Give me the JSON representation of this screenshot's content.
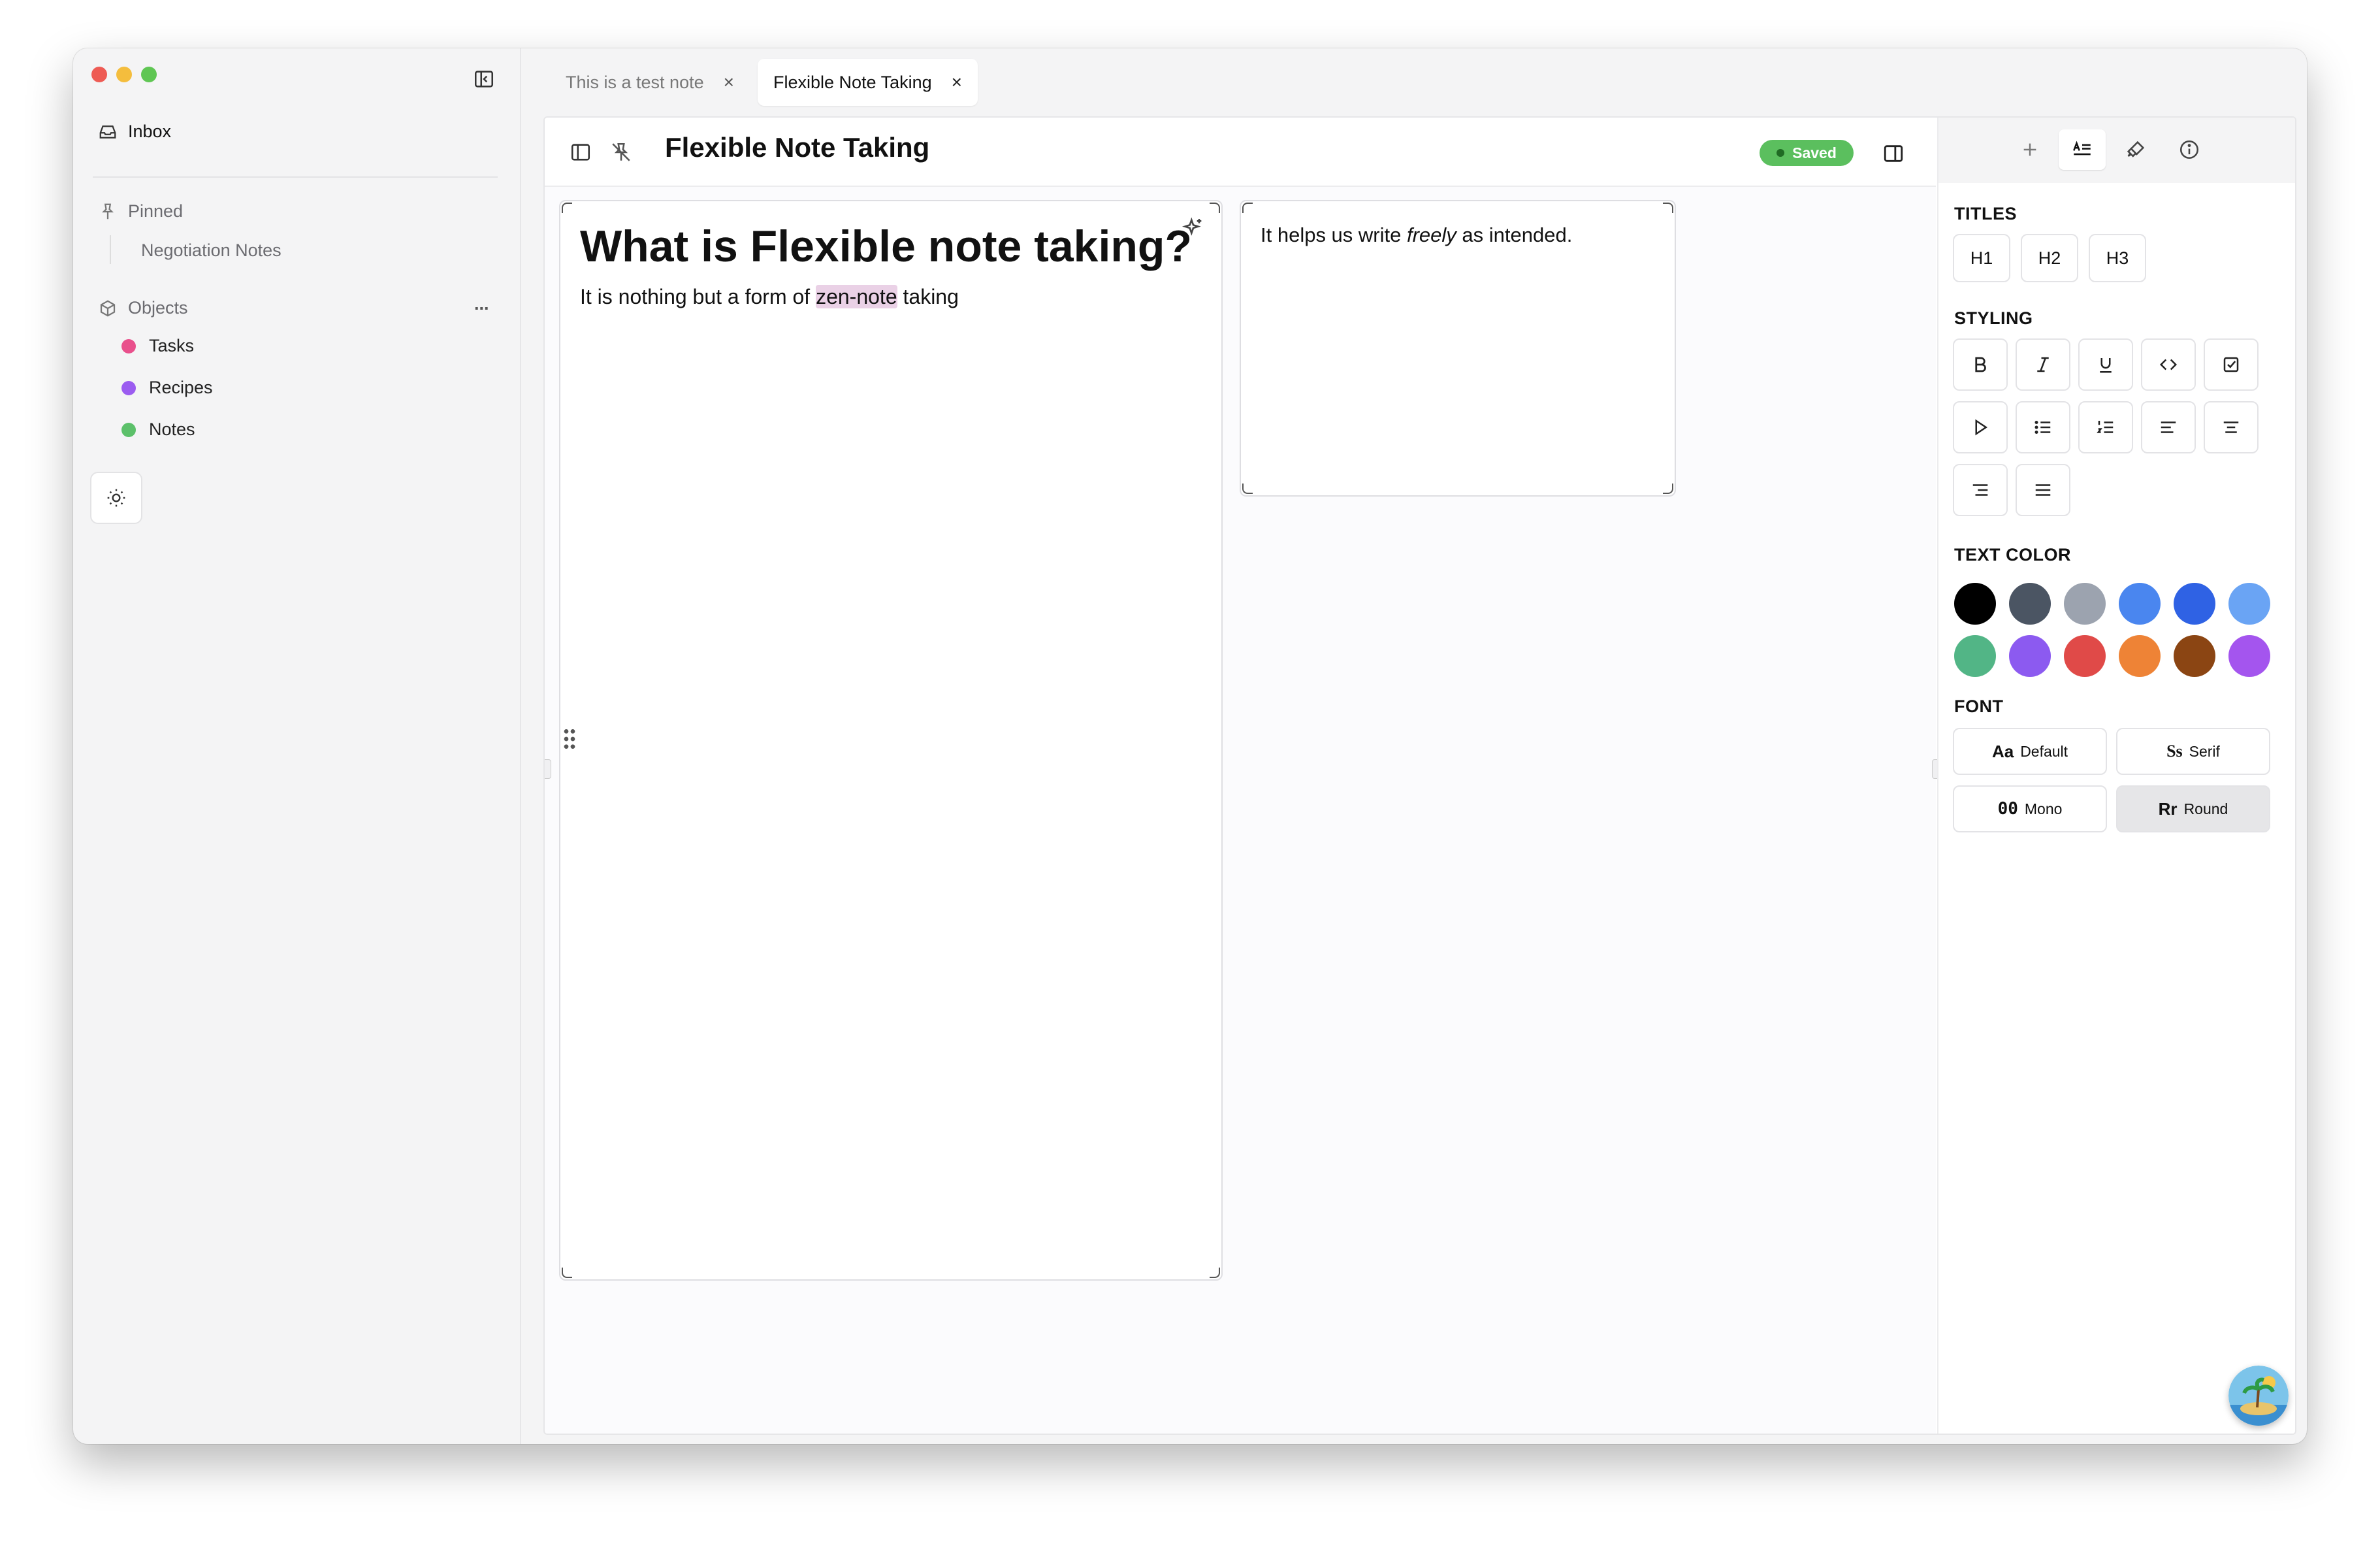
{
  "tabs": [
    {
      "label": "This is a test note",
      "active": false
    },
    {
      "label": "Flexible Note Taking",
      "active": true
    }
  ],
  "sidebar": {
    "inbox": "Inbox",
    "pinned_label": "Pinned",
    "pinned_items": [
      "Negotiation Notes"
    ],
    "objects_label": "Objects",
    "objects_more": "...",
    "objects": [
      {
        "label": "Tasks",
        "color": "#e9508c"
      },
      {
        "label": "Recipes",
        "color": "#9b5cf0"
      },
      {
        "label": "Notes",
        "color": "#5cc06a"
      }
    ]
  },
  "note": {
    "title": "Flexible Note Taking",
    "status": "Saved",
    "block1": {
      "heading": "What is Flexible note taking?",
      "text_before": "It is nothing but a form of ",
      "highlight": "zen-note",
      "text_after": " taking"
    },
    "block2": {
      "text_before": "It helps us write ",
      "italic": "freely",
      "text_after": " as intended."
    }
  },
  "panel": {
    "titles_label": "TITLES",
    "titles": [
      "H1",
      "H2",
      "H3"
    ],
    "styling_label": "STYLING",
    "styling_icons": [
      "bold-icon",
      "italic-icon",
      "underline-icon",
      "code-icon",
      "checkbox-icon",
      "toggle-icon",
      "bullet-list-icon",
      "numbered-list-icon",
      "align-left-icon",
      "align-center-icon",
      "align-right-icon",
      "align-justify-icon"
    ],
    "text_color_label": "TEXT COLOR",
    "colors": [
      "#000000",
      "#4b5563",
      "#9ca3af",
      "#4a86ef",
      "#2f62e4",
      "#6aa4f4",
      "#52b586",
      "#8c5af0",
      "#e04a48",
      "#ee8336",
      "#8b4513",
      "#a455ee"
    ],
    "font_label": "FONT",
    "fonts": [
      {
        "glyph": "Aa",
        "label": "Default",
        "selected": false
      },
      {
        "glyph": "Ss",
        "label": "Serif",
        "selected": false
      },
      {
        "glyph": "00",
        "label": "Mono",
        "selected": false
      },
      {
        "glyph": "Rr",
        "label": "Round",
        "selected": true
      }
    ]
  }
}
